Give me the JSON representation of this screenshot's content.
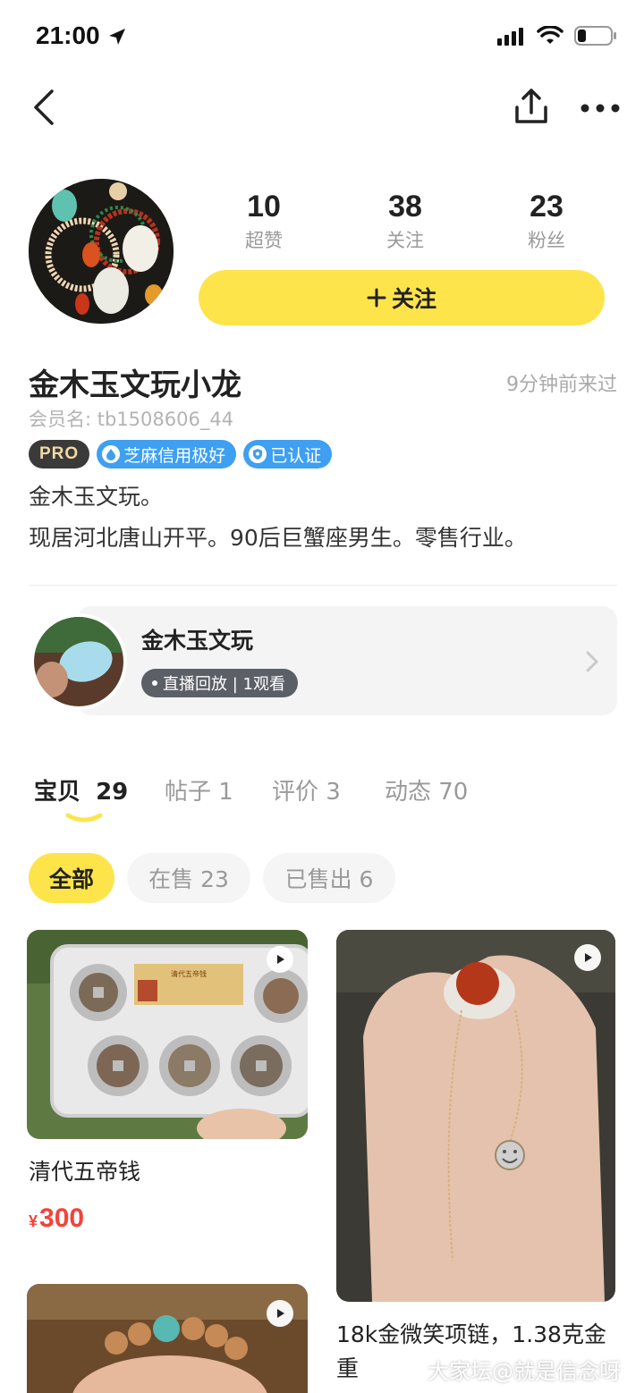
{
  "status_bar": {
    "time": "21:00"
  },
  "profile": {
    "stats": [
      {
        "num": "10",
        "label": "超赞"
      },
      {
        "num": "38",
        "label": "关注"
      },
      {
        "num": "23",
        "label": "粉丝"
      }
    ],
    "follow_label": "关注",
    "username": "金木玉文玩小龙",
    "last_visit": "9分钟前来过",
    "member_id": "会员名: tb1508606_44",
    "badges": {
      "pro": "PRO",
      "credit": "芝麻信用极好",
      "verified": "已认证"
    },
    "bio_line1": "金木玉文玩。",
    "bio_line2": "现居河北唐山开平。90后巨蟹座男生。零售行业。"
  },
  "live": {
    "title": "金木玉文玩",
    "tag": "直播回放 | 1观看"
  },
  "tabs": [
    {
      "label": "宝贝",
      "count": "29"
    },
    {
      "label": "帖子 1"
    },
    {
      "label": "评价 3"
    },
    {
      "label": "动态 70"
    }
  ],
  "filters": [
    "全部",
    "在售 23",
    "已售出 6"
  ],
  "products": [
    {
      "title": "清代五帝钱",
      "currency": "¥",
      "price": "300",
      "plaque_text": "清代五帝钱"
    },
    {
      "title_line1": "18k金微笑项链，1.38克金",
      "title_line2": "重"
    }
  ],
  "watermark": "大家坛@就是信念呀",
  "colors": {
    "accent_yellow": "#fde44a",
    "price_red": "#f5423a",
    "badge_blue": "#3f9ff1"
  }
}
